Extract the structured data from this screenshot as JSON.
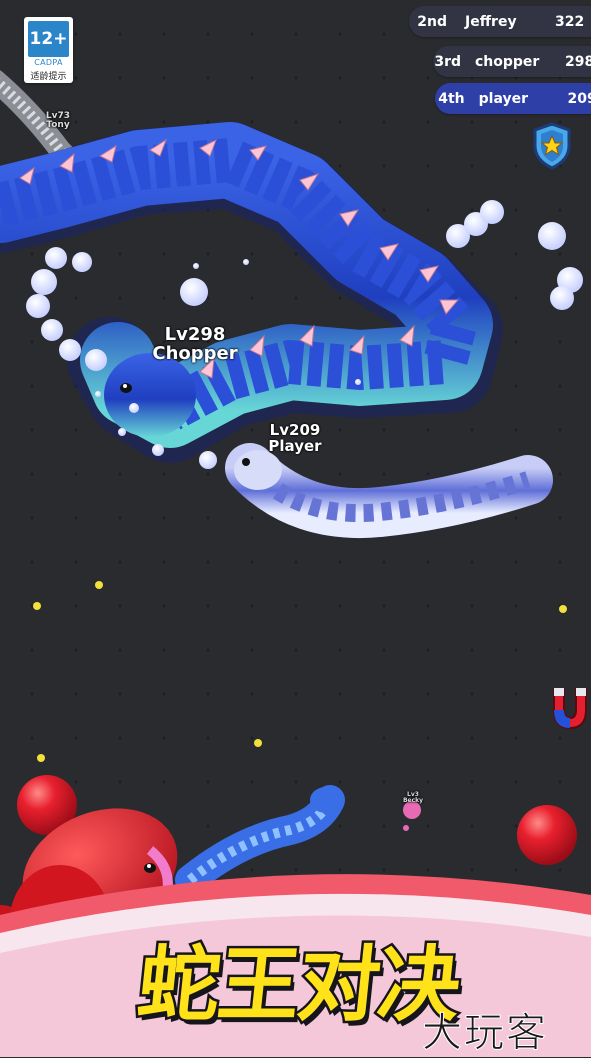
{
  "game": {
    "title": "蛇王对决",
    "watermark": "大玩客"
  },
  "age_rating": {
    "label": "12+",
    "org": "CADPA",
    "note": "适龄提示"
  },
  "leaderboard": [
    {
      "rank": "2nd",
      "name": "Jeffrey",
      "score": "322"
    },
    {
      "rank": "3rd",
      "name": "chopper",
      "score": "298"
    },
    {
      "rank": "4th",
      "name": "player",
      "score": "209"
    }
  ],
  "snakes": {
    "tony": {
      "level": "Lv73",
      "name": "Tony"
    },
    "chopper": {
      "level": "Lv298",
      "name": "Chopper"
    },
    "player": {
      "level": "Lv209",
      "name": "Player"
    },
    "small": {
      "level": "Lv3",
      "name": "Becky"
    }
  },
  "colors": {
    "arena": "#2a2b2f",
    "big_snake": "#2547c9",
    "player_snake": "#8c9be8",
    "red_snake": "#e8202e",
    "title": "#ffe21a",
    "leaderboard_self": "#2f3fa8"
  },
  "icons": {
    "shield": "shield-star-icon",
    "magnet": "magnet-icon"
  }
}
